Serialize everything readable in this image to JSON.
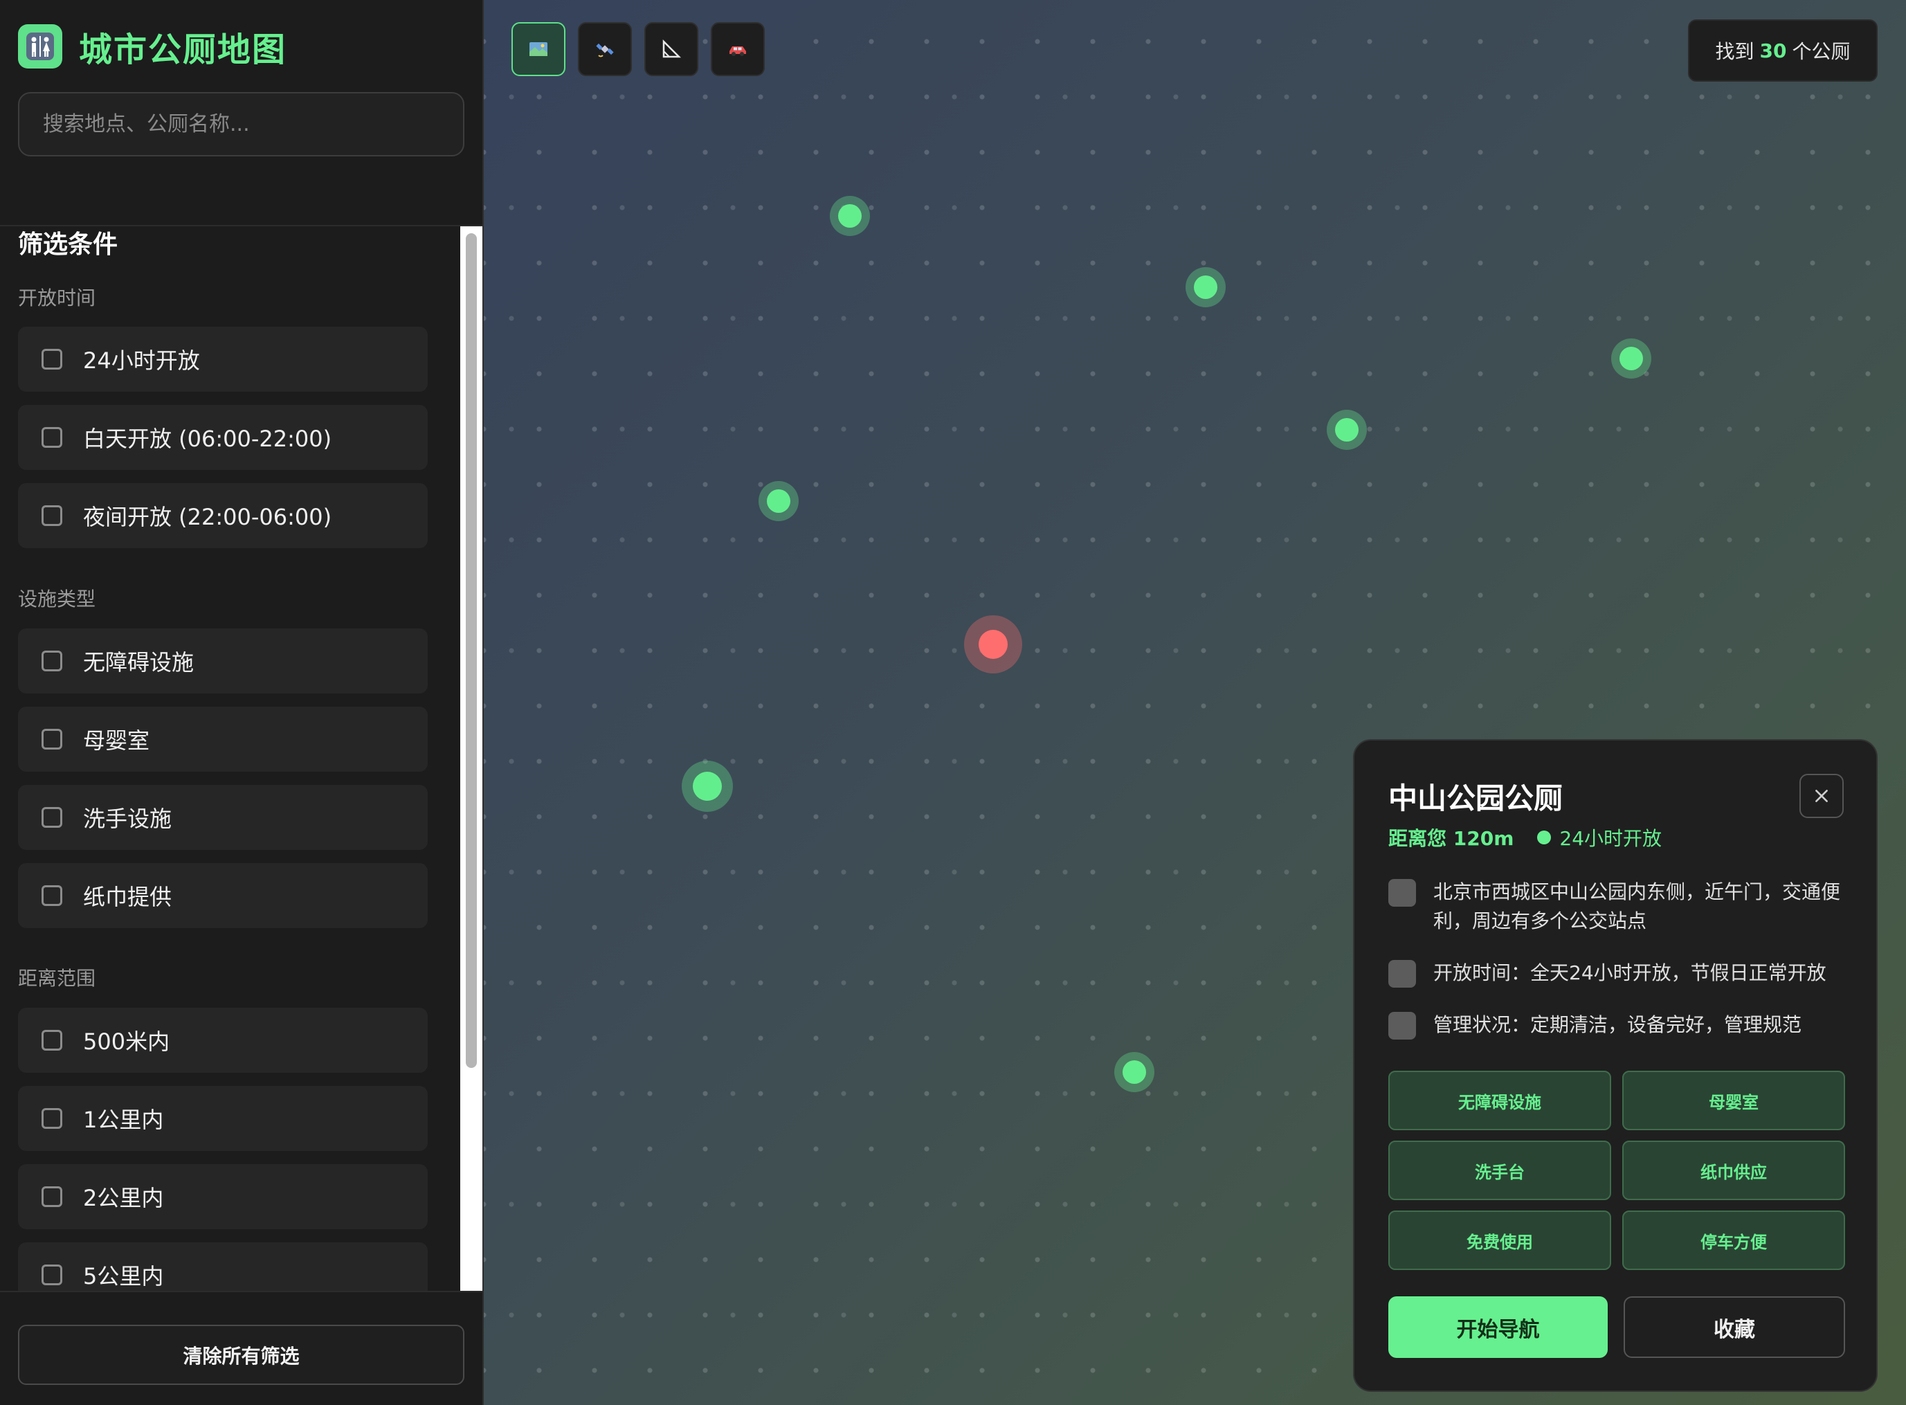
{
  "app": {
    "title": "城市公厕地图",
    "logo_icon": "restroom-icon"
  },
  "search": {
    "placeholder": "搜索地点、公厕名称..."
  },
  "filters": {
    "title": "筛选条件",
    "groups": [
      {
        "label": "开放时间",
        "options": [
          "24小时开放",
          "白天开放 (06:00-22:00)",
          "夜间开放 (22:00-06:00)"
        ]
      },
      {
        "label": "设施类型",
        "options": [
          "无障碍设施",
          "母婴室",
          "洗手设施",
          "纸巾提供"
        ]
      },
      {
        "label": "距离范围",
        "options": [
          "500米内",
          "1公里内",
          "2公里内",
          "5公里内"
        ]
      }
    ],
    "clear_label": "清除所有筛选"
  },
  "map": {
    "tools": [
      {
        "name": "map-view-icon",
        "active": true
      },
      {
        "name": "satellite-icon",
        "active": false
      },
      {
        "name": "measure-icon",
        "active": false
      },
      {
        "name": "car-icon",
        "active": false
      }
    ],
    "count": {
      "prefix": "找到",
      "value": "30",
      "suffix": "个公厕"
    }
  },
  "detail": {
    "name": "中山公园公厕",
    "distance": "距离您 120m",
    "hours_badge": "24小时开放",
    "info": [
      {
        "icon": "location-icon",
        "text": "北京市西城区中山公园内东侧，近午门，交通便利，周边有多个公交站点"
      },
      {
        "icon": "clock-icon",
        "text": "开放时间：全天24小时开放，节假日正常开放"
      },
      {
        "icon": "management-icon",
        "text": "管理状况：定期清洁，设备完好，管理规范"
      }
    ],
    "tags": [
      "无障碍设施",
      "母婴室",
      "洗手台",
      "纸巾供应",
      "免费使用",
      "停车方便"
    ],
    "navigate_label": "开始导航",
    "favorite_label": "收藏"
  },
  "colors": {
    "accent": "#66f08f",
    "user_pin": "#ff6e6e",
    "panel": "#1c1c1c"
  }
}
